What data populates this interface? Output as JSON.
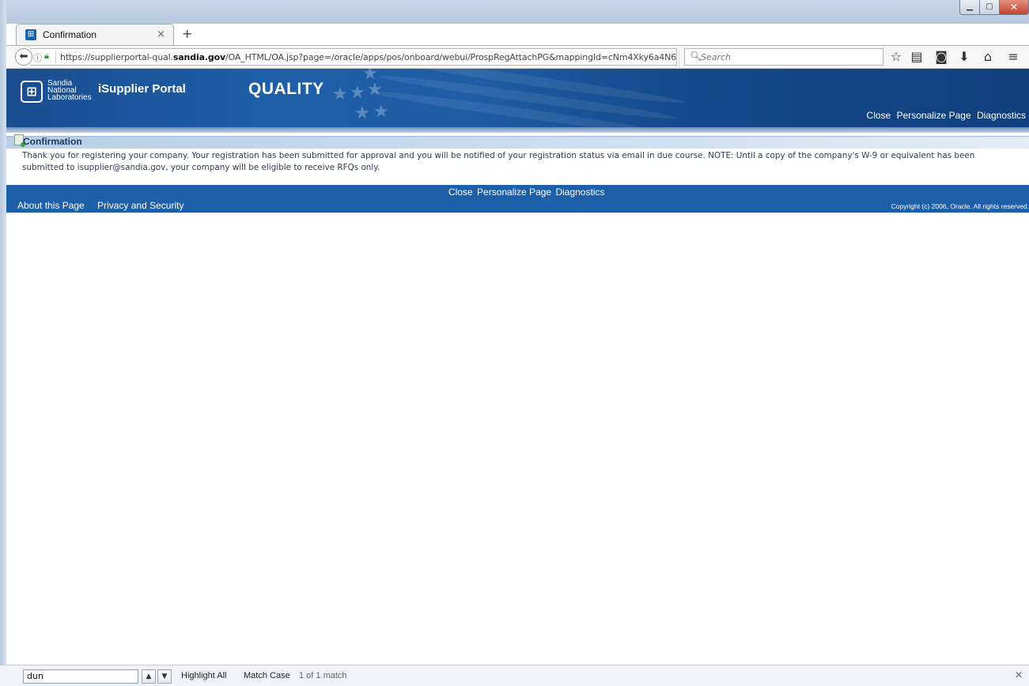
{
  "browser": {
    "tab_title": "Confirmation",
    "tab_close": "×",
    "new_tab": "+",
    "url_prefix": "https://supplierportal-qual.",
    "url_domain": "sandia.gov",
    "url_path": "/OA_HTML/OA.jsp?page=/oracle/apps/pos/onboard/webui/ProspRegAttachPG&mappingId=cNm4Xky6a4N6",
    "search_placeholder": "Search"
  },
  "header": {
    "logo_line1": "Sandia",
    "logo_line2": "National",
    "logo_line3": "Laboratories",
    "portal_name": "iSupplier Portal",
    "environment": "QUALITY",
    "links": [
      "Close",
      "Personalize Page",
      "Diagnostics"
    ]
  },
  "confirmation": {
    "title": "Confirmation",
    "message": "Thank you for registering your company. Your registration has been submitted for approval and you will be notified of your registration status via email in due course. NOTE: Until a copy of the company's W-9 or equivalent has been submitted to isupplier@sandia.gov, your company will be eligible to receive RFQs only."
  },
  "footer": {
    "links": [
      "Close",
      "Personalize Page",
      "Diagnostics"
    ],
    "left_links": [
      "About this Page",
      "Privacy and Security"
    ],
    "copyright": "Copyright (c) 2006, Oracle. All rights reserved."
  },
  "findbar": {
    "query": "dun",
    "highlight_all": "Highlight All",
    "match_case": "Match Case",
    "status": "1 of 1 match"
  }
}
